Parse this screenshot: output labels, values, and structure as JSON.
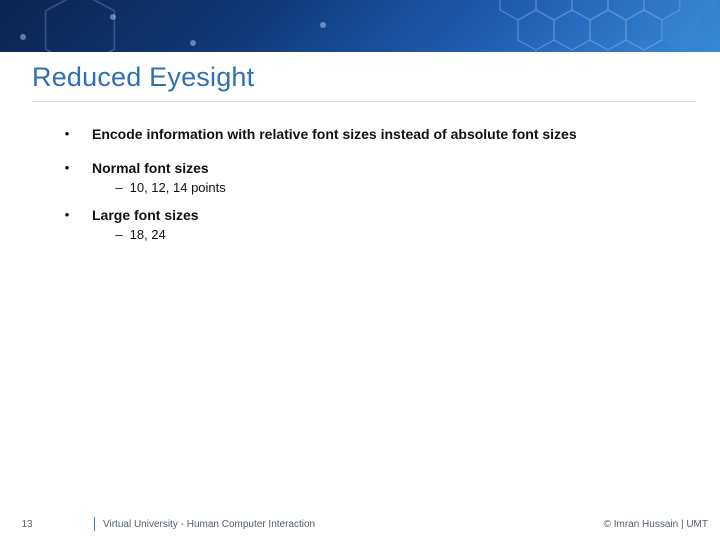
{
  "slide": {
    "title": "Reduced Eyesight",
    "bullets": [
      {
        "text": "Encode information with relative font sizes instead of absolute font sizes",
        "subs": []
      },
      {
        "text": "Normal font sizes",
        "subs": [
          "10, 12, 14 points"
        ]
      },
      {
        "text": "Large font sizes",
        "subs": [
          "18, 24"
        ]
      }
    ]
  },
  "footer": {
    "page_number": "13",
    "course": "Virtual University - Human Computer Interaction",
    "credit": "© Imran Hussain | UMT"
  }
}
